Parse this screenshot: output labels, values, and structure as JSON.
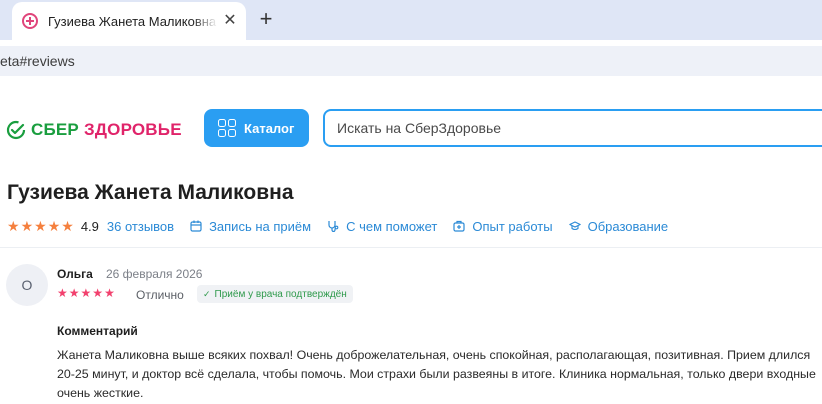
{
  "browser": {
    "tab_title": "Гузиева Жанета Маликовна - с",
    "url": "eta#reviews"
  },
  "site": {
    "logo_part1": "СБЕР",
    "logo_part2": "ЗДОРОВЬЕ",
    "catalog_label": "Каталог",
    "search_placeholder": "Искать на СберЗдоровье"
  },
  "doctor": {
    "name": "Гузиева Жанета Маликовна",
    "rating": "4.9",
    "stars": 5,
    "reviews_link": "36 отзывов",
    "nav": [
      "Запись на приём",
      "С чем поможет",
      "Опыт работы",
      "Образование"
    ]
  },
  "review": {
    "avatar_letter": "О",
    "author": "Ольга",
    "date": "26 февраля 2026",
    "stars": 5,
    "rating_text": "Отлично",
    "badge": "Приём у врача подтверждён",
    "comment_title": "Комментарий",
    "comment_text": "Жанета Маликовна выше всяких похвал! Очень доброжелательная, очень спокойная, располагающая, позитивная. Прием длился 20-25 минут, и доктор всё сделала, чтобы помочь. Мои страхи были развеяны в итоге. Клиника нормальная, только двери входные очень жесткие."
  },
  "colors": {
    "accent": "#2a9ef2",
    "brand_green": "#1a9e3f",
    "brand_pink": "#e0246a",
    "star_orange": "#f5803e",
    "star_pink": "#f2416e"
  }
}
